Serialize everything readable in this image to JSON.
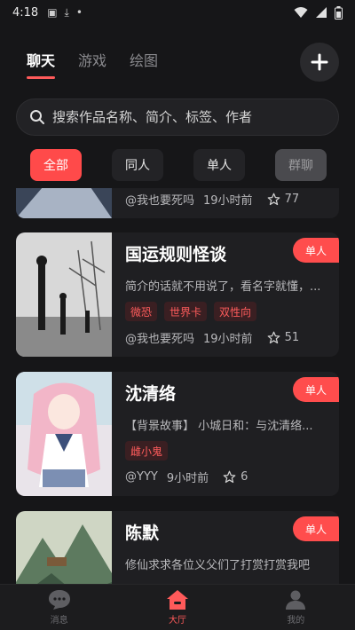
{
  "status_bar": {
    "time": "4:18"
  },
  "tabs": [
    {
      "label": "聊天",
      "active": true
    },
    {
      "label": "游戏",
      "active": false
    },
    {
      "label": "绘图",
      "active": false
    }
  ],
  "search": {
    "placeholder": "搜索作品名称、简介、标签、作者"
  },
  "filters": [
    {
      "label": "全部",
      "state": "active"
    },
    {
      "label": "同人",
      "state": "normal"
    },
    {
      "label": "单人",
      "state": "normal"
    },
    {
      "label": "群聊",
      "state": "muted"
    }
  ],
  "cards": [
    {
      "title": "",
      "desc": "",
      "badge": "",
      "tags": [],
      "author": "@我也要死吗",
      "time": "19小时前",
      "stars": "77"
    },
    {
      "title": "国运规则怪谈",
      "desc": "简介的话就不用说了，看名字就懂，...",
      "badge": "单人",
      "tags": [
        "微恐",
        "世界卡",
        "双性向"
      ],
      "author": "@我也要死吗",
      "time": "19小时前",
      "stars": "51"
    },
    {
      "title": "沈清络",
      "desc": "【背景故事】 小城日和：与沈清络...",
      "badge": "单人",
      "tags": [
        "雌小鬼"
      ],
      "author": "@YYY",
      "time": "9小时前",
      "stars": "6"
    },
    {
      "title": "陈默",
      "desc": "修仙求求各位义父们了打赏打赏我吧",
      "badge": "单人",
      "tags": [],
      "author": "",
      "time": "",
      "stars": ""
    }
  ],
  "bottom_nav": [
    {
      "label": "消息",
      "icon": "chat-bubble-icon"
    },
    {
      "label": "大厅",
      "icon": "home-icon",
      "active": true
    },
    {
      "label": "我的",
      "icon": "person-icon"
    }
  ],
  "colors": {
    "accent": "#ff4d4d",
    "background": "#161618",
    "card": "#1f1f22"
  }
}
